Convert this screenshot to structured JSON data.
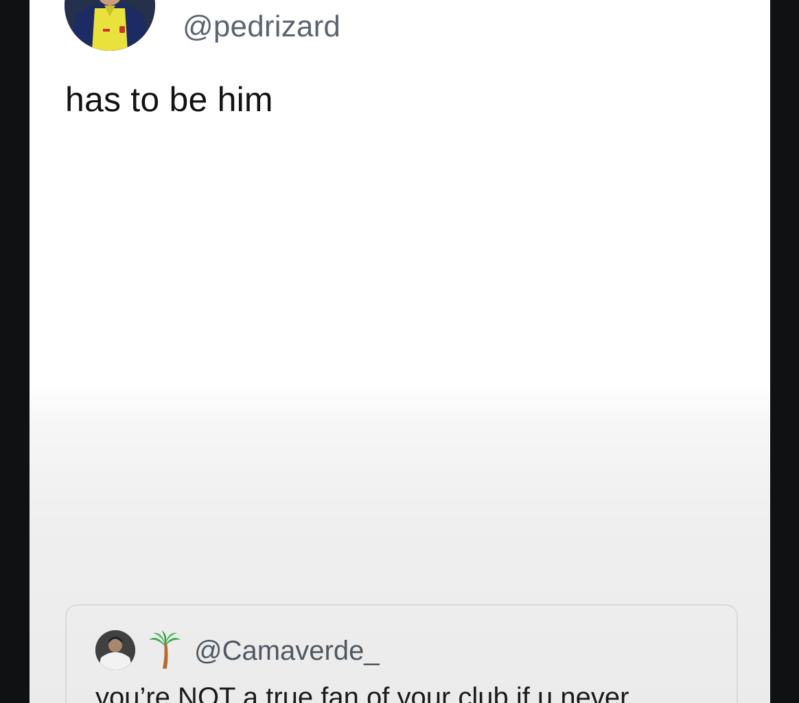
{
  "tweet": {
    "handle": "@pedrizard",
    "text": "has to be him",
    "avatar_icon": "user-avatar-photo"
  },
  "quoted_tweet": {
    "emoji": "🌴",
    "handle": "@Camaverde_",
    "text": "you’re NOT a true fan of your club if u never",
    "avatar_icon": "user-avatar-photo"
  },
  "colors": {
    "frame": "#0f1113",
    "card": "#ffffff",
    "handle": "#5b6570",
    "text": "#121212"
  }
}
